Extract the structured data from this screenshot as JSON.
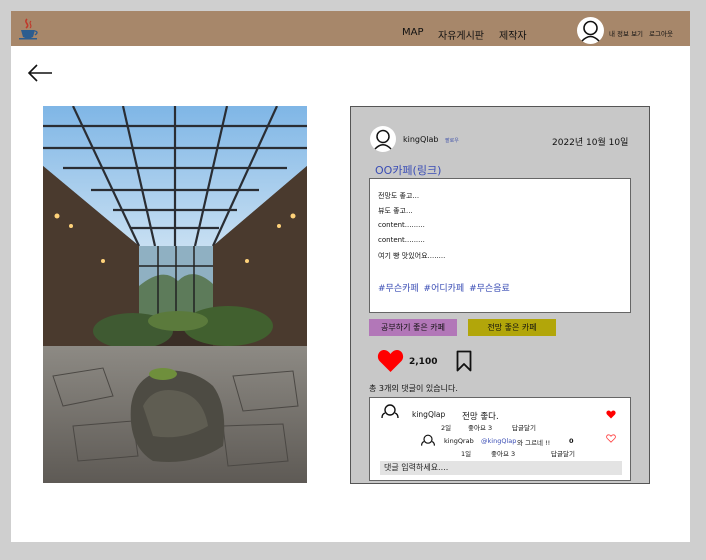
{
  "nav": {
    "items": [
      {
        "label": "MAP"
      },
      {
        "label": "자유게시판"
      },
      {
        "label": "제작자"
      }
    ],
    "my_info_label": "내 정보 보기",
    "logout_label": "로그아웃"
  },
  "post": {
    "author": "kingQlab",
    "follow_label": "팔로우",
    "date": "2022년 10월 10일",
    "place_link": "OO카페(링크)",
    "content_lines": [
      "전망도 좋고...",
      "뷰도 좋고...",
      "content.........",
      "content.........",
      "여기 빵 맛있어요........"
    ],
    "hashtags": [
      "#무슨카페",
      "#어디카페",
      "#무슨음료"
    ],
    "tags": [
      {
        "label": "공부하기 좋은 카페",
        "color": "#b277b8"
      },
      {
        "label": "전망 좋은 카페",
        "color": "#b2a60a"
      }
    ],
    "likes": "2,100",
    "comment_count_text": "총 3개의 댓글이 있습니다."
  },
  "comments": [
    {
      "user": "kingQlap",
      "text": "전망 좋다.",
      "age": "2일",
      "likes": "좋아요 3",
      "reply": "답글달기",
      "liked": true
    },
    {
      "user": "kingQrab",
      "mention": "@kingQlap",
      "text": "와 그르네 !!",
      "count": "0",
      "age": "1일",
      "likes": "좋아요 3",
      "reply": "답글달기",
      "liked": false
    }
  ],
  "comment_input": {
    "placeholder": "댓글 입력하세요...."
  },
  "colors": {
    "topbar": "#a7876a",
    "card": "#c8c8c8",
    "heart": "#ff0000",
    "link": "#3a4db5"
  }
}
